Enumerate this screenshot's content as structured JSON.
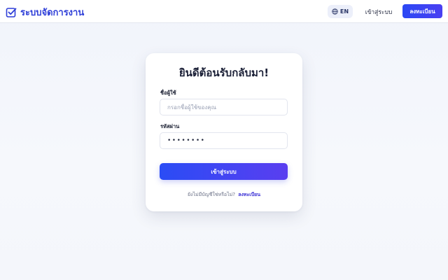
{
  "header": {
    "brand_title": "ระบบจัดการงาน",
    "brand_icon": "checkbox-icon",
    "lang_label": "EN",
    "lang_icon": "globe-icon",
    "login_label": "เข้าสู่ระบบ",
    "register_label": "ลงทะเบียน"
  },
  "card": {
    "title": "ยินดีต้อนรับกลับมา!",
    "username_label": "ชื่อผู้ใช้",
    "username_placeholder": "กรอกชื่อผู้ใช้ของคุณ",
    "password_label": "รหัสผ่าน",
    "password_value": "••••••••",
    "submit_label": "เข้าสู่ระบบ",
    "signup_prompt": "ยังไม่มีบัญชีใช่หรือไม่?",
    "signup_link": "ลงทะเบียน"
  },
  "colors": {
    "accent": "#2f3fd8",
    "button_gradient_start": "#2a4cf5",
    "button_gradient_end": "#5a3ef0"
  }
}
